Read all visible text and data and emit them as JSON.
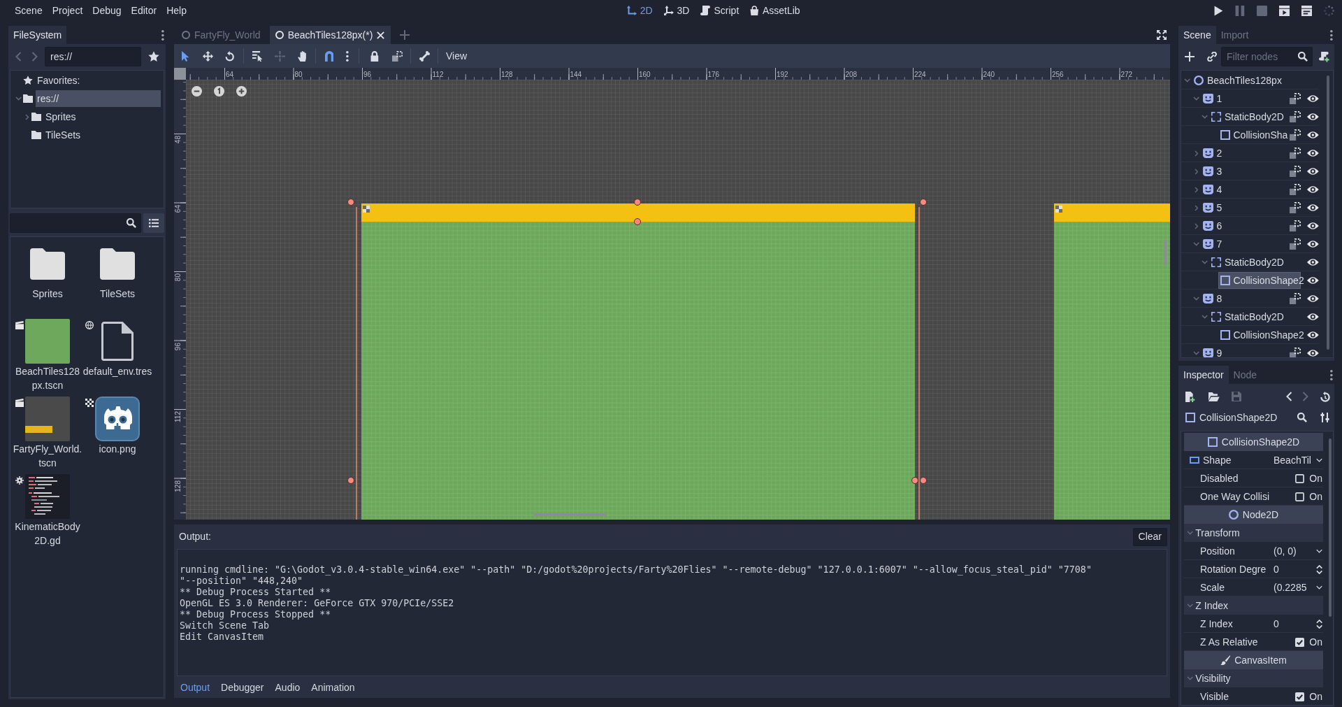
{
  "menu": [
    "Scene",
    "Project",
    "Debug",
    "Editor",
    "Help"
  ],
  "workspaces": [
    {
      "label": "2D",
      "selected": true
    },
    {
      "label": "3D",
      "selected": false
    },
    {
      "label": "Script",
      "selected": false
    },
    {
      "label": "AssetLib",
      "selected": false
    }
  ],
  "filesystem": {
    "tabs": [
      {
        "label": "FileSystem",
        "selected": true
      }
    ],
    "path": "res://",
    "tree": [
      {
        "label": "Favorites:",
        "kind": "favorites",
        "selected": false
      },
      {
        "label": "res://",
        "kind": "folder",
        "expanded": true,
        "selected": true,
        "children": [
          {
            "label": "Sprites",
            "kind": "folder",
            "expanded": false,
            "selected": false
          },
          {
            "label": "TileSets",
            "kind": "folder",
            "selected": false
          }
        ]
      }
    ],
    "files": [
      {
        "name": "Sprites",
        "kind": "folder"
      },
      {
        "name": "TileSets",
        "kind": "folder"
      },
      {
        "name": "BeachTiles128px.tscn",
        "kind": "scene"
      },
      {
        "name": "default_env.tres",
        "kind": "resource"
      },
      {
        "name": "FartyFly_World.tscn",
        "kind": "scene"
      },
      {
        "name": "icon.png",
        "kind": "image"
      },
      {
        "name": "KinematicBody2D.gd",
        "kind": "script"
      }
    ]
  },
  "editor_tabs": [
    {
      "label": "FartyFly_World",
      "selected": false
    },
    {
      "label": "BeachTiles128px(*)",
      "selected": true
    }
  ],
  "toolbar": {
    "menu": "View"
  },
  "rulers": {
    "horizontal": [
      "64",
      "80",
      "96",
      "112",
      "128",
      "144",
      "160",
      "176",
      "192",
      "208",
      "224",
      "240",
      "256",
      "272"
    ],
    "vertical": [
      "48",
      "64",
      "80",
      "96",
      "112",
      "128"
    ]
  },
  "output": {
    "title": "Output:",
    "clear": "Clear",
    "lines": [
      "running cmdline: \"G:\\Godot_v3.0.4-stable_win64.exe\" \"--path\" \"D:/godot%20projects/Farty%20Flies\" \"--remote-debug\" \"127.0.0.1:6007\" \"--allow_focus_steal_pid\" \"7708\"",
      "\"--position\" \"448,240\"",
      "** Debug Process Started **",
      "OpenGL ES 3.0 Renderer: GeForce GTX 970/PCIe/SSE2",
      "** Debug Process Stopped **",
      "Switch Scene Tab",
      "Edit CanvasItem"
    ],
    "tabs": [
      {
        "label": "Output",
        "selected": true
      },
      {
        "label": "Debugger",
        "selected": false
      },
      {
        "label": "Audio",
        "selected": false
      },
      {
        "label": "Animation",
        "selected": false
      }
    ]
  },
  "scene": {
    "tabs": [
      {
        "label": "Scene",
        "selected": true
      },
      {
        "label": "Import",
        "selected": false
      }
    ],
    "filter": {
      "placeholder": "Filter nodes"
    },
    "tree": [
      {
        "label": "BeachTiles128px",
        "kind": "node2d",
        "expanded": true,
        "selected": false,
        "children": [
          {
            "label": "1",
            "kind": "sprite",
            "expanded": true,
            "selected": false,
            "grouped": true,
            "visible": true,
            "children": [
              {
                "label": "StaticBody2D",
                "kind": "body",
                "expanded": true,
                "selected": false,
                "grouped": true,
                "visible": true,
                "children": [
                  {
                    "label": "CollisionSha",
                    "kind": "shape",
                    "selected": false,
                    "grouped": true,
                    "visible": true
                  }
                ]
              }
            ]
          },
          {
            "label": "2",
            "kind": "sprite",
            "expanded": false,
            "selected": false,
            "grouped": true,
            "visible": true
          },
          {
            "label": "3",
            "kind": "sprite",
            "expanded": false,
            "selected": false,
            "grouped": true,
            "visible": true
          },
          {
            "label": "4",
            "kind": "sprite",
            "expanded": false,
            "selected": false,
            "grouped": true,
            "visible": true
          },
          {
            "label": "5",
            "kind": "sprite",
            "expanded": false,
            "selected": false,
            "grouped": true,
            "visible": true
          },
          {
            "label": "6",
            "kind": "sprite",
            "expanded": false,
            "selected": false,
            "grouped": true,
            "visible": true
          },
          {
            "label": "7",
            "kind": "sprite",
            "expanded": true,
            "selected": false,
            "grouped": true,
            "visible": true,
            "children": [
              {
                "label": "StaticBody2D",
                "kind": "body",
                "expanded": true,
                "selected": false,
                "grouped": false,
                "visible": true,
                "children": [
                  {
                    "label": "CollisionShape2",
                    "kind": "shape",
                    "selected": true,
                    "grouped": false,
                    "visible": true
                  }
                ]
              }
            ]
          },
          {
            "label": "8",
            "kind": "sprite",
            "expanded": true,
            "selected": false,
            "grouped": true,
            "visible": true,
            "children": [
              {
                "label": "StaticBody2D",
                "kind": "body",
                "expanded": true,
                "selected": false,
                "grouped": false,
                "visible": true,
                "children": [
                  {
                    "label": "CollisionShape2",
                    "kind": "shape",
                    "selected": false,
                    "grouped": false,
                    "visible": true
                  }
                ]
              }
            ]
          },
          {
            "label": "9",
            "kind": "sprite",
            "expanded": true,
            "selected": false,
            "grouped": true,
            "visible": true
          }
        ]
      }
    ]
  },
  "inspector": {
    "tabs": [
      {
        "label": "Inspector",
        "selected": true
      },
      {
        "label": "Node",
        "selected": false
      }
    ],
    "object": "CollisionShape2D",
    "properties": [
      {
        "kind": "class",
        "label": "CollisionShape2D"
      },
      {
        "kind": "resource",
        "label": "Shape",
        "value": "BeachTil"
      },
      {
        "kind": "check",
        "label": "Disabled",
        "value": "On",
        "checked": false
      },
      {
        "kind": "check",
        "label": "One Way Collisi",
        "value": "On",
        "checked": false
      },
      {
        "kind": "class",
        "label": "Node2D"
      },
      {
        "kind": "group",
        "label": "Transform",
        "expanded": true
      },
      {
        "kind": "vector",
        "label": "Position",
        "value": "(0, 0)"
      },
      {
        "kind": "number",
        "label": "Rotation Degre",
        "value": "0"
      },
      {
        "kind": "vector",
        "label": "Scale",
        "value": "(0.2285"
      },
      {
        "kind": "group",
        "label": "Z Index",
        "expanded": true
      },
      {
        "kind": "number",
        "label": "Z Index",
        "value": "0"
      },
      {
        "kind": "check",
        "label": "Z As Relative",
        "value": "On",
        "checked": true
      },
      {
        "kind": "class",
        "label": "CanvasItem"
      },
      {
        "kind": "group",
        "label": "Visibility",
        "expanded": true
      },
      {
        "kind": "check",
        "label": "Visible",
        "value": "On",
        "checked": true
      }
    ]
  }
}
